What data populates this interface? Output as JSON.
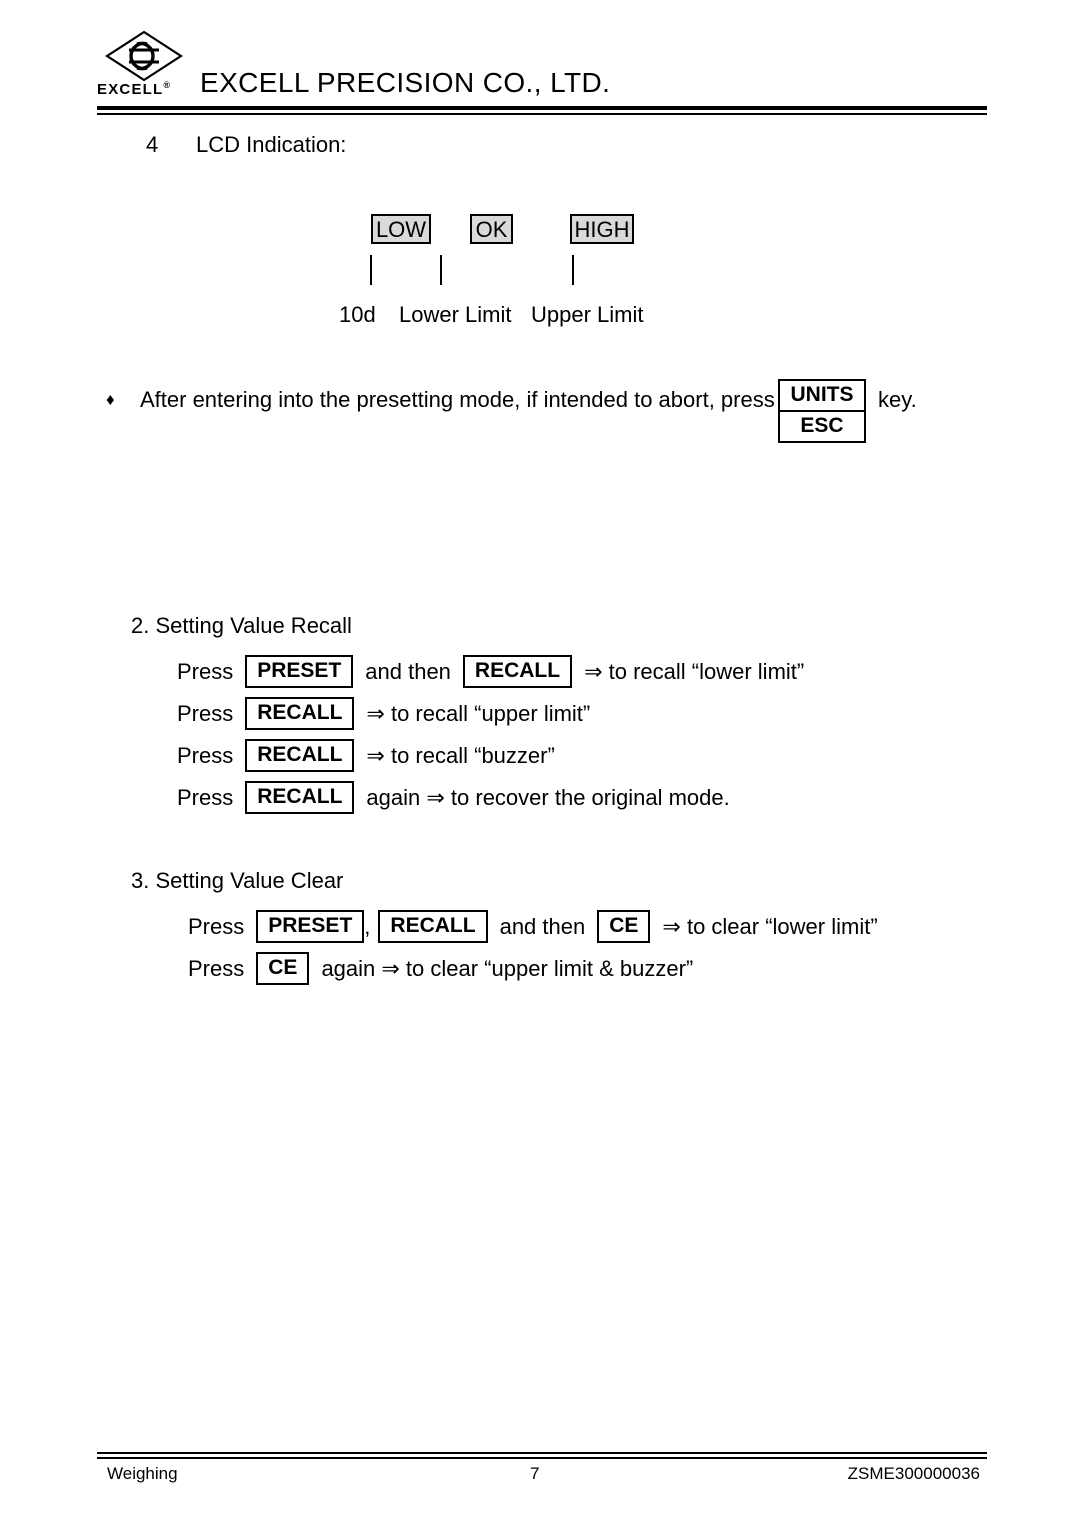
{
  "header": {
    "logo_wordmark": "EXCELL",
    "logo_registered": "®",
    "company_name": "EXCELL PRECISION CO., LTD."
  },
  "body": {
    "item_number": "4",
    "item_title": "LCD Indication:",
    "lcd_diagram": {
      "boxes": [
        {
          "label": "LOW"
        },
        {
          "label": "OK"
        },
        {
          "label": "HIGH"
        }
      ],
      "captions": [
        {
          "text": "10d"
        },
        {
          "text": "Lower Limit"
        },
        {
          "text": "Upper Limit"
        }
      ]
    },
    "bullet": {
      "marker": "♦",
      "text": "After entering into the presetting mode, if intended to abort, press",
      "key_top": "UNITS",
      "key_bottom": "ESC",
      "suffix": "key."
    },
    "section2": {
      "heading": "2. Setting Value Recall",
      "lines": [
        {
          "press": "Press",
          "key1": "PRESET",
          "mid": "and then",
          "key2": "RECALL",
          "tail": "⇒ to recall “lower limit”"
        },
        {
          "press": "Press",
          "key1": "RECALL",
          "tail": "⇒ to recall “upper limit”"
        },
        {
          "press": "Press",
          "key1": "RECALL",
          "tail": "⇒ to recall “buzzer”"
        },
        {
          "press": "Press",
          "key1": "RECALL",
          "tail": "again ⇒ to recover the original mode."
        }
      ]
    },
    "section3": {
      "heading": "3. Setting Value Clear",
      "lines": [
        {
          "press": "Press",
          "key1": "PRESET",
          "comma": ",",
          "key2": "RECALL",
          "mid": "and then",
          "key3": "CE",
          "tail": "⇒ to clear “lower limit”"
        },
        {
          "press": "Press",
          "key1": "CE",
          "tail": "again ⇒ to clear “upper limit & buzzer”"
        }
      ]
    }
  },
  "footer": {
    "left": "Weighing",
    "page_number": "7",
    "doc_code": "ZSME300000036"
  },
  "colors": {
    "ink": "#000000",
    "paper": "#ffffff",
    "lcd_box_fill": "#d9d9d9"
  }
}
